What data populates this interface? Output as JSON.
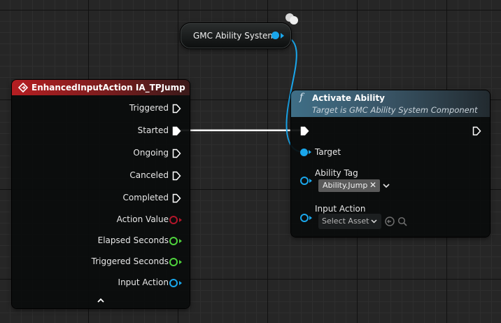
{
  "get_node": {
    "label": "GMC Ability System"
  },
  "event_node": {
    "title": "EnhancedInputAction IA_TPJump",
    "outputs": [
      {
        "label": "Triggered",
        "type": "exec"
      },
      {
        "label": "Started",
        "type": "exec"
      },
      {
        "label": "Ongoing",
        "type": "exec"
      },
      {
        "label": "Canceled",
        "type": "exec"
      },
      {
        "label": "Completed",
        "type": "exec"
      },
      {
        "label": "Action Value",
        "type": "data",
        "color": "#b3172b"
      },
      {
        "label": "Elapsed Seconds",
        "type": "data",
        "color": "#4fd33d"
      },
      {
        "label": "Triggered Seconds",
        "type": "data",
        "color": "#4fd33d"
      },
      {
        "label": "Input Action",
        "type": "data",
        "color": "#1aa7ec"
      }
    ],
    "collapse_icon": "chevron-up-icon"
  },
  "function_node": {
    "icon": "f",
    "title": "Activate Ability",
    "subtitle": "Target is GMC Ability System Component",
    "target_label": "Target",
    "ability_tag_label": "Ability Tag",
    "ability_tag_value": "Ability.Jump",
    "clear_glyph": "✕",
    "input_action_label": "Input Action",
    "select_placeholder": "Select Asset"
  },
  "colors": {
    "object_pin": "#1aa7ec",
    "exec_wire": "#ffffff",
    "event_header": "#b51e22",
    "function_header": "#3f6e86"
  }
}
